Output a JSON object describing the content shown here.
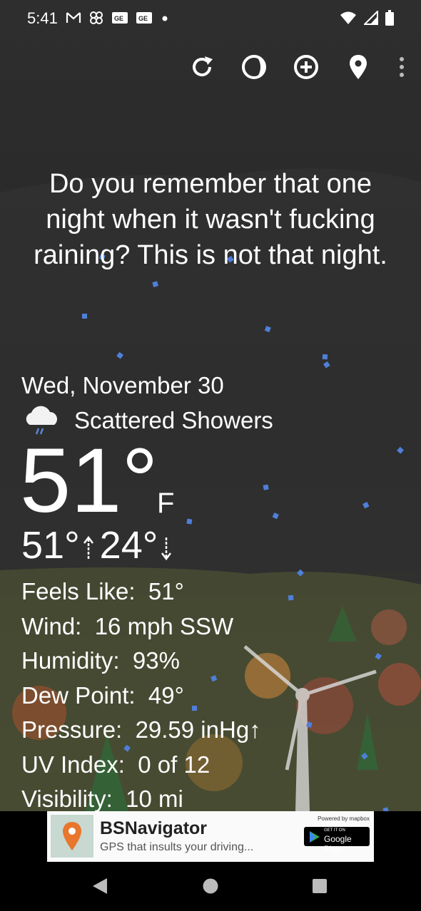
{
  "status_bar": {
    "time": "5:41",
    "left_icons": [
      "gmail-icon",
      "pinwheel-icon",
      "news-icon",
      "news-icon",
      "dot-icon"
    ],
    "right_icons": [
      "wifi-icon",
      "signal-icon",
      "battery-icon"
    ]
  },
  "toolbar": {
    "buttons": [
      "refresh-icon",
      "moon-phase-icon",
      "add-icon",
      "location-icon",
      "more-icon"
    ]
  },
  "snark_text": "Do you remember that one night when it wasn't fucking raining? This is not that night.",
  "weather": {
    "date": "Wed, November 30",
    "condition": "Scattered Showers",
    "condition_icon": "cloud-rain-icon",
    "temperature": "51°",
    "unit": "F",
    "high": "51°",
    "low": "24°",
    "details": [
      {
        "label": "Feels Like:",
        "value": "51°"
      },
      {
        "label": "Wind:",
        "value": "16 mph SSW"
      },
      {
        "label": "Humidity:",
        "value": "93%"
      },
      {
        "label": "Dew Point:",
        "value": "49°"
      },
      {
        "label": "Pressure:",
        "value": "29.59 inHg↑"
      },
      {
        "label": "UV Index:",
        "value": "0 of 12"
      },
      {
        "label": "Visibility:",
        "value": "10 mi"
      }
    ]
  },
  "ad": {
    "title": "BSNavigator",
    "subtitle": "GPS that insults your driving...",
    "powered_by": "Powered by mapbox",
    "store_top": "GET IT ON",
    "store_bottom": "Google Play"
  },
  "nav": [
    "back-icon",
    "home-icon",
    "recents-icon"
  ],
  "colors": {
    "rain_drop": "#4f7fd9",
    "text": "#ffffff"
  }
}
